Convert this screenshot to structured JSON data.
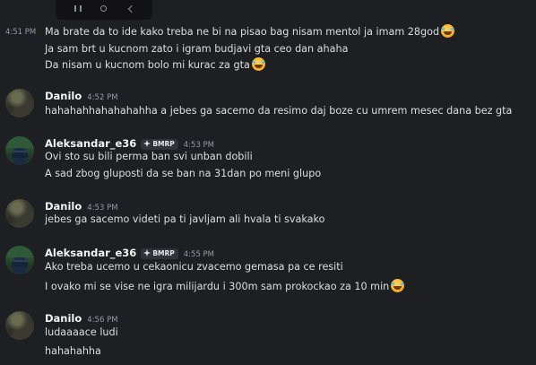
{
  "top_bar": {
    "icons": [
      "pause-icon",
      "home-circle-icon",
      "back-chevron-icon"
    ]
  },
  "continuation": {
    "time": "4:51 PM",
    "lines": [
      "Ma brate da to ide kako treba ne bi na pisao bag nisam mentol ja imam 28god",
      "Ja sam brt u kucnom zato i igram budjavi gta ceo dan ahaha",
      "Da nisam u kucnom bolo mi kurac za gta"
    ]
  },
  "messages": [
    {
      "username": "Danilo",
      "time": "4:52 PM",
      "lines": [
        "hahahahhahahahahha a jebes ga sacemo da resimo daj boze cu umrem mesec dana bez gta"
      ]
    },
    {
      "username": "Aleksandar_e36",
      "badge": "BMRP",
      "time": "4:53 PM",
      "lines": [
        "Ovi sto su bili perma ban svi unban dobili",
        "A sad zbog gluposti da se ban na 31dan po meni glupo"
      ]
    },
    {
      "username": "Danilo",
      "time": "4:53 PM",
      "lines": [
        "jebes ga sacemo videti pa ti javljam ali hvala ti svakako"
      ]
    },
    {
      "username": "Aleksandar_e36",
      "badge": "BMRP",
      "time": "4:55 PM",
      "lines": [
        "Ako treba ucemo u cekaonicu zvacemo gemasa pa ce resiti",
        "I ovako mi se vise ne igra milijardu i 300m sam prokockao za 10 min"
      ]
    },
    {
      "username": "Danilo",
      "time": "4:56 PM",
      "lines": [
        "ludaaaace ludi",
        "hahahahha"
      ]
    }
  ],
  "colors": {
    "background": "#1e1f22",
    "text": "#dbdee1",
    "username": "#f2f3f5",
    "timestamp": "#949ba4"
  },
  "emoji_name": "rolling-on-floor-laughing-emoji"
}
